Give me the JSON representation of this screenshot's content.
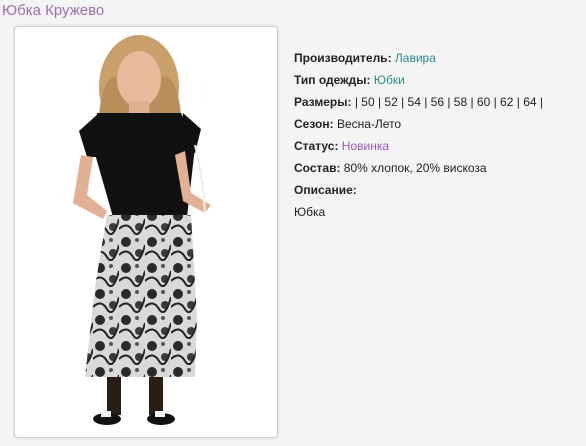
{
  "product": {
    "title": "Юбка Кружево",
    "manufacturer": {
      "label": "Производитель:",
      "value": "Лавира"
    },
    "clothing_type": {
      "label": "Тип одежды:",
      "value": "Юбки"
    },
    "sizes": {
      "label": "Размеры:",
      "value": " | 50 | 52 | 54 | 56 | 58 | 60 | 62 | 64 |"
    },
    "season": {
      "label": "Сезон:",
      "value": " Весна-Лето"
    },
    "status": {
      "label": "Статус:",
      "value": "Новинка"
    },
    "composition": {
      "label": "Состав:",
      "value": " 80% хлопок, 20% вискоза"
    },
    "description": {
      "label": "Описание:",
      "text": "Юбка"
    }
  },
  "colors": {
    "title": "#9a72b0",
    "link_teal": "#2f8a8c",
    "link_purple": "#9a5bbf",
    "background": "#f4f4f4"
  }
}
